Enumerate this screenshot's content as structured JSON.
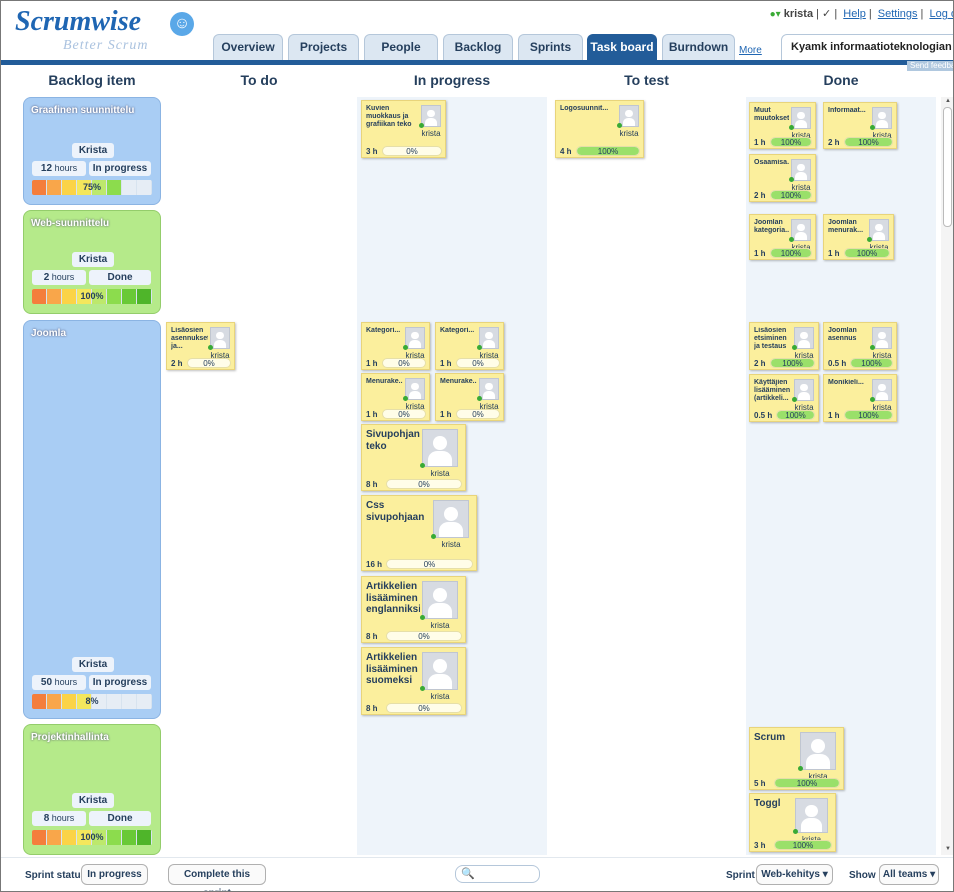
{
  "header": {
    "logo": "Scrumwise",
    "tagline": "Better Scrum",
    "user": "krista",
    "help": "Help",
    "settings": "Settings",
    "logout": "Log o",
    "tabs": [
      "Overview",
      "Projects",
      "People",
      "Backlog",
      "Sprints",
      "Task board",
      "Burndown"
    ],
    "more": "More",
    "project": "Kyamk informaatioteknologian web-...",
    "feedback": "Send feedba"
  },
  "columns": [
    "Backlog item",
    "To do",
    "In progress",
    "To test",
    "Done"
  ],
  "lanes": [
    {
      "title": "Graafinen suunnittelu",
      "owner": "Krista",
      "hours": "12",
      "hours_unit": "hours",
      "status": "In progress",
      "progress": "75%",
      "progress_value": 0.75,
      "color": "blue"
    },
    {
      "title": "Web-suunnittelu",
      "owner": "Krista",
      "hours": "2",
      "hours_unit": "hours",
      "status": "Done",
      "progress": "100%",
      "progress_value": 1.0,
      "color": "green"
    },
    {
      "title": "Joomla",
      "owner": "Krista",
      "hours": "50",
      "hours_unit": "hours",
      "status": "In progress",
      "progress": "8%",
      "progress_value": 0.08,
      "color": "blue"
    },
    {
      "title": "Projektinhallinta",
      "owner": "Krista",
      "hours": "8",
      "hours_unit": "hours",
      "status": "Done",
      "progress": "100%",
      "progress_value": 1.0,
      "color": "green"
    }
  ],
  "cards": [
    {
      "title": "Kuvien muokkaus ja grafiikan teko",
      "user": "krista",
      "hours": "3 h",
      "pct": "0%",
      "pct_value": 0
    },
    {
      "title": "Logosuunnit...",
      "user": "krista",
      "hours": "4 h",
      "pct": "100%",
      "pct_value": 1
    },
    {
      "title": "Muut muutokset",
      "user": "krista",
      "hours": "1 h",
      "pct": "100%",
      "pct_value": 1
    },
    {
      "title": "Informaat...",
      "user": "krista",
      "hours": "2 h",
      "pct": "100%",
      "pct_value": 1
    },
    {
      "title": "Osaamisa...",
      "user": "krista",
      "hours": "2 h",
      "pct": "100%",
      "pct_value": 1
    },
    {
      "title": "Joomlan kategoria...",
      "user": "krista",
      "hours": "1 h",
      "pct": "100%",
      "pct_value": 1
    },
    {
      "title": "Joomlan menurak...",
      "user": "krista",
      "hours": "1 h",
      "pct": "100%",
      "pct_value": 1
    },
    {
      "title": "Lisäosien asennukset ja...",
      "user": "krista",
      "hours": "2 h",
      "pct": "0%",
      "pct_value": 0
    },
    {
      "title": "Kategori...",
      "user": "krista",
      "hours": "1 h",
      "pct": "0%",
      "pct_value": 0
    },
    {
      "title": "Kategori...",
      "user": "krista",
      "hours": "1 h",
      "pct": "0%",
      "pct_value": 0
    },
    {
      "title": "Menurake...",
      "user": "krista",
      "hours": "1 h",
      "pct": "0%",
      "pct_value": 0
    },
    {
      "title": "Menurake...",
      "user": "krista",
      "hours": "1 h",
      "pct": "0%",
      "pct_value": 0
    },
    {
      "title": "Sivupohjan teko",
      "user": "krista",
      "hours": "8 h",
      "pct": "0%",
      "pct_value": 0
    },
    {
      "title": "Css sivupohjaan",
      "user": "krista",
      "hours": "16 h",
      "pct": "0%",
      "pct_value": 0
    },
    {
      "title": "Artikkelien lisääminen englanniksi",
      "user": "krista",
      "hours": "8 h",
      "pct": "0%",
      "pct_value": 0
    },
    {
      "title": "Artikkelien lisääminen suomeksi",
      "user": "krista",
      "hours": "8 h",
      "pct": "0%",
      "pct_value": 0
    },
    {
      "title": "Lisäosien etsiminen ja testaus",
      "user": "krista",
      "hours": "2 h",
      "pct": "100%",
      "pct_value": 1
    },
    {
      "title": "Joomlan asennus",
      "user": "krista",
      "hours": "0.5 h",
      "pct": "100%",
      "pct_value": 1
    },
    {
      "title": "Käyttäjien lisääminen (artikkeli...",
      "user": "krista",
      "hours": "0.5 h",
      "pct": "100%",
      "pct_value": 1
    },
    {
      "title": "Monikieli...",
      "user": "krista",
      "hours": "1 h",
      "pct": "100%",
      "pct_value": 1
    },
    {
      "title": "Scrum",
      "user": "krista",
      "hours": "5 h",
      "pct": "100%",
      "pct_value": 1
    },
    {
      "title": "Toggl",
      "user": "krista",
      "hours": "3 h",
      "pct": "100%",
      "pct_value": 1
    }
  ],
  "footer": {
    "sprint_status_label": "Sprint status",
    "sprint_status": "In progress",
    "complete_button": "Complete this sprint",
    "sprint_label": "Sprint",
    "sprint_value": "Web-kehitys ▾",
    "show_label": "Show",
    "show_value": "All teams ▾"
  }
}
